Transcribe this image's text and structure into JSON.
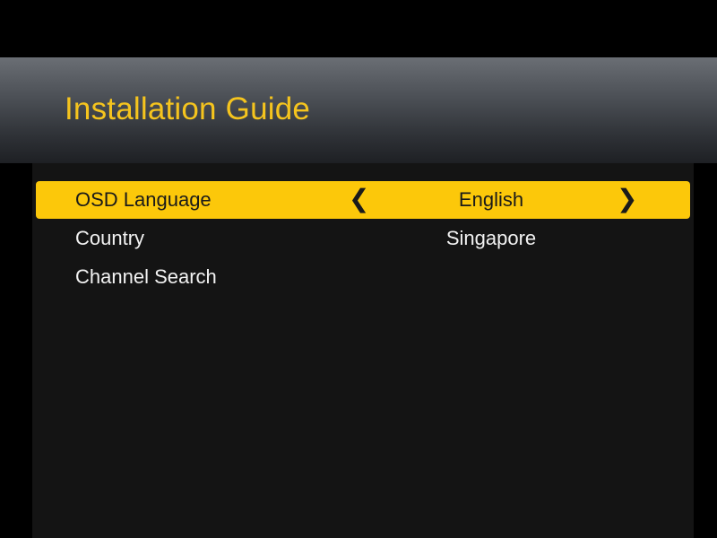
{
  "header": {
    "title": "Installation Guide"
  },
  "menu": {
    "items": [
      {
        "label": "OSD Language",
        "value": "English",
        "selected": true,
        "left_arrow": "❮",
        "right_arrow": "❯"
      },
      {
        "label": "Country",
        "value": "Singapore",
        "selected": false
      },
      {
        "label": "Channel Search",
        "value": "",
        "selected": false
      }
    ]
  },
  "colors": {
    "accent": "#fcc80a",
    "title": "#f5c41e",
    "background": "#000000",
    "panel": "#141414",
    "text": "#f2f2f2"
  }
}
